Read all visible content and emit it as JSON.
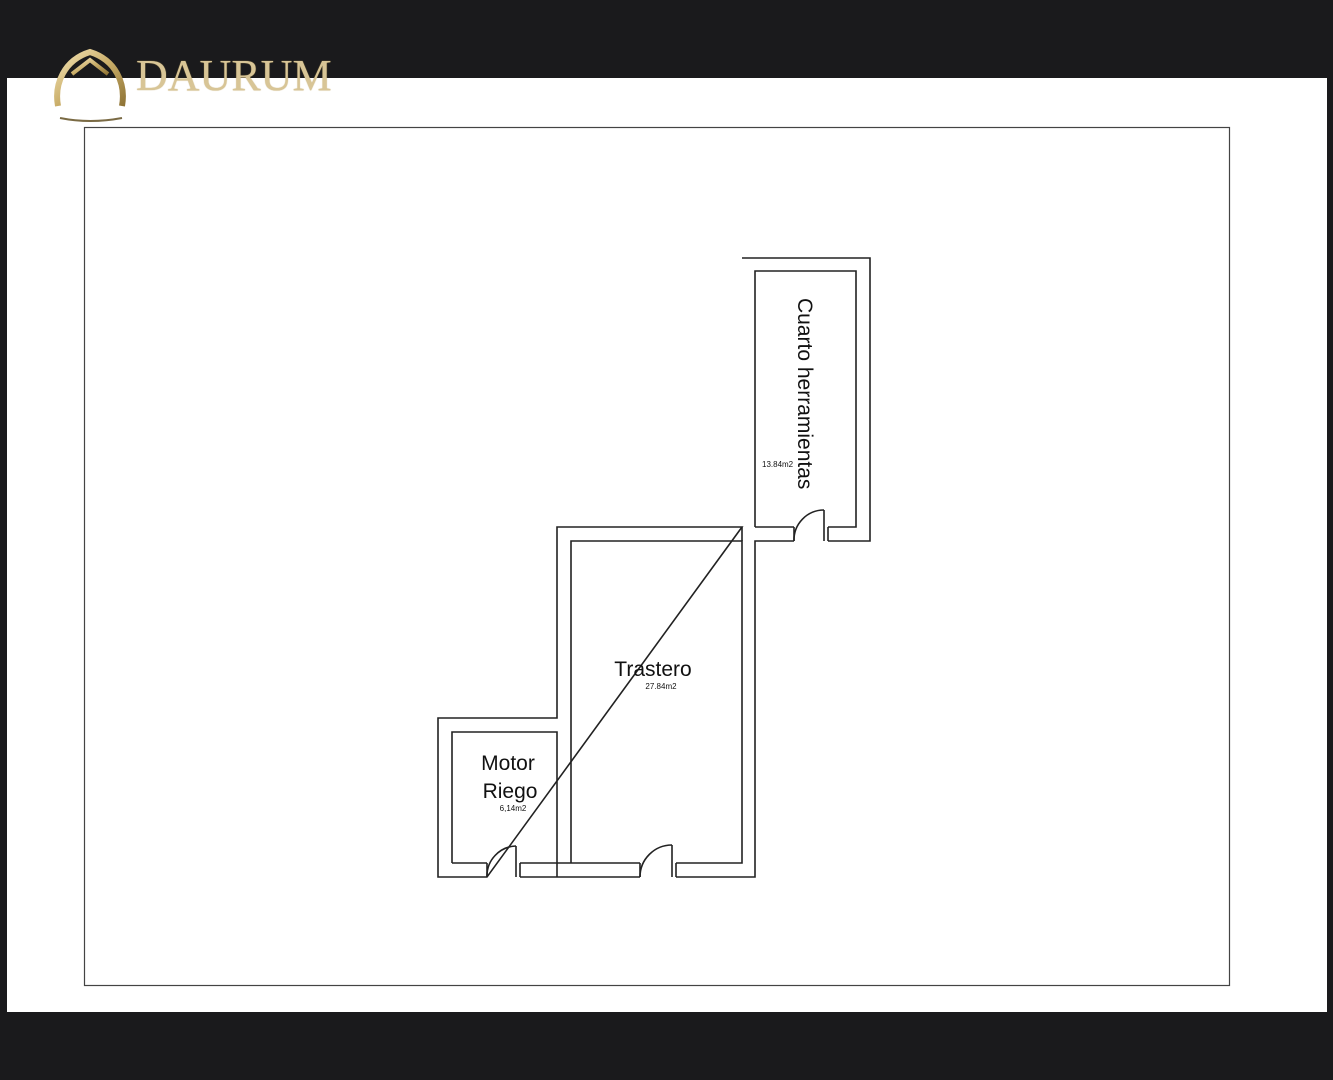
{
  "brand": {
    "name": "DAURUM",
    "accent_color": "#d8c596",
    "icon": "house-arch-logo-icon"
  },
  "colors": {
    "background": "#1a1a1c",
    "sheet": "#ffffff",
    "lines": "#222222"
  },
  "rooms": [
    {
      "name": "Cuarto herramientas",
      "area": "13.84m2"
    },
    {
      "name": "Trastero",
      "area": "27.84m2"
    },
    {
      "name_line1": "Motor",
      "name_line2": "Riego",
      "area": "6,14m2"
    }
  ]
}
